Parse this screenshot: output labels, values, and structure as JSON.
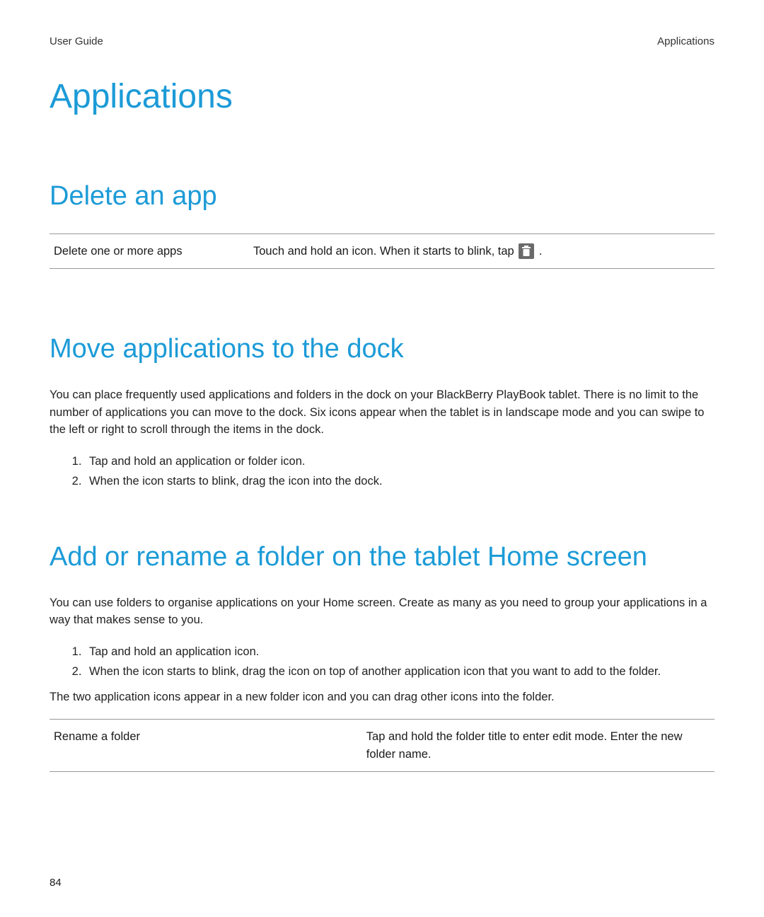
{
  "header": {
    "left": "User Guide",
    "right": "Applications"
  },
  "page_title": "Applications",
  "sections": {
    "delete": {
      "title": "Delete an app",
      "table": {
        "label": "Delete one or more apps",
        "value_before": "Touch and hold an icon. When it starts to blink, tap ",
        "value_after": " ."
      }
    },
    "move": {
      "title": "Move applications to the dock",
      "para": "You can place frequently used applications and folders in the dock on your BlackBerry PlayBook tablet. There is no limit to the number of applications you can move to the dock. Six icons appear when the tablet is in landscape mode and you can swipe to the left or right to scroll through the items in the dock.",
      "steps": [
        "Tap and hold an application or folder icon.",
        "When the icon starts to blink, drag the icon into the dock."
      ]
    },
    "folder": {
      "title": "Add or rename a folder on the tablet Home screen",
      "para1": "You can use folders to organise applications on your Home screen. Create as many as you need to group your applications in a way that makes sense to you.",
      "steps": [
        "Tap and hold an application icon.",
        "When the icon starts to blink, drag the icon on top of another application icon that you want to add to the folder."
      ],
      "para2": "The two application icons appear in a new folder icon and you can drag other icons into the folder.",
      "table": {
        "label": "Rename a folder",
        "value": "Tap and hold the folder title to enter edit mode. Enter the new folder name."
      }
    }
  },
  "page_number": "84"
}
